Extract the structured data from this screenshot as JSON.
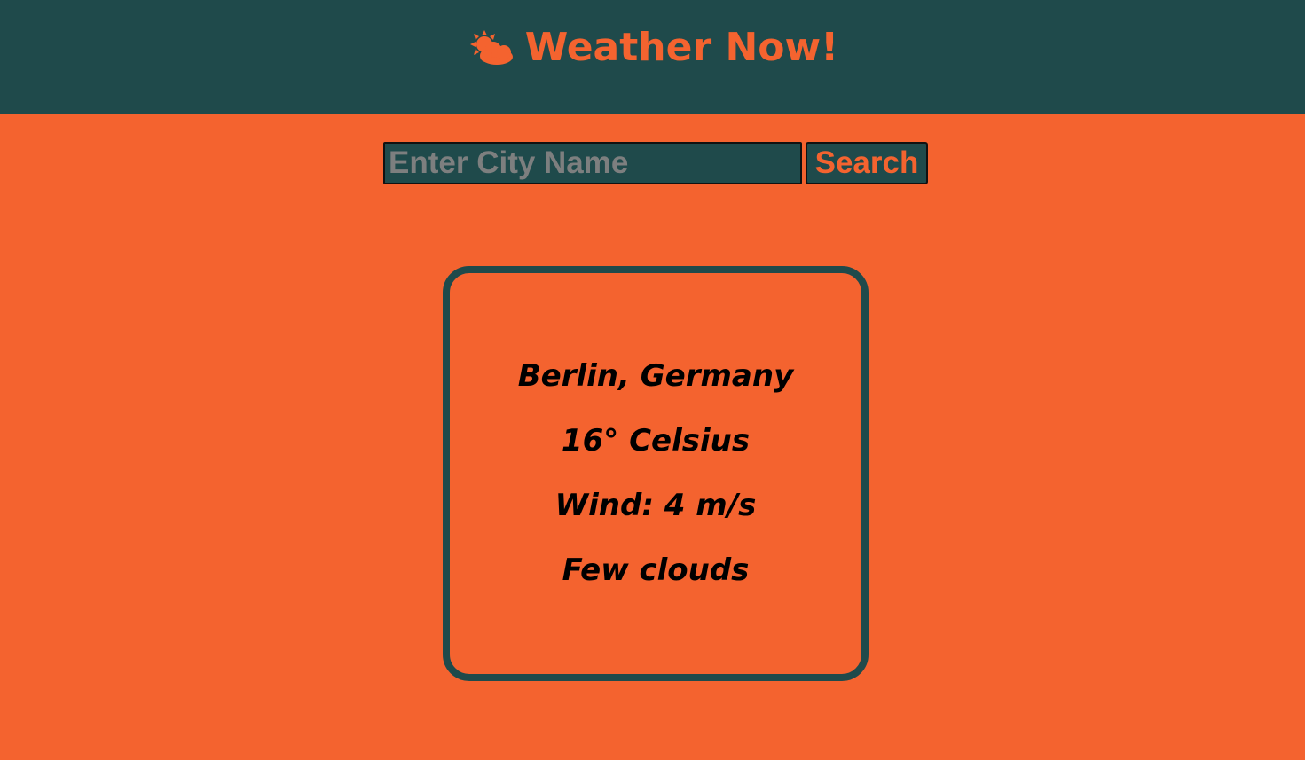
{
  "header": {
    "icon": "sun-behind-cloud-icon",
    "title": "Weather Now!"
  },
  "search": {
    "placeholder": "Enter City Name",
    "value": "",
    "button_label": "Search"
  },
  "weather": {
    "location": "Berlin, Germany",
    "temperature": "16° Celsius",
    "wind": "Wind: 4 m/s",
    "description": "Few clouds"
  },
  "colors": {
    "background": "#f4632f",
    "header": "#1f4a4b",
    "accent": "#f4632f",
    "border": "#1f4a4b",
    "placeholder": "#7d7f7f"
  }
}
